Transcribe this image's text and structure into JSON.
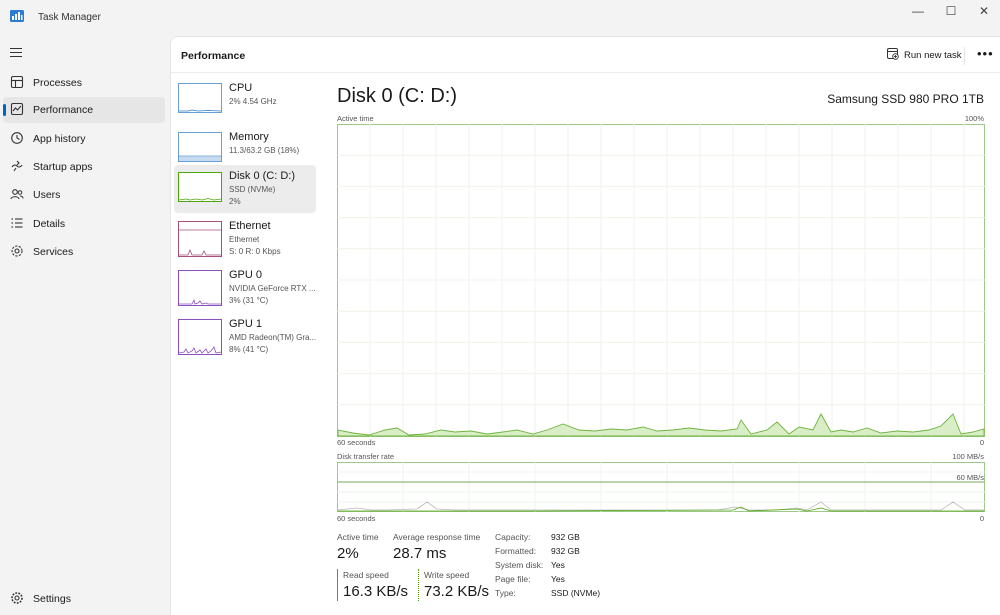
{
  "window": {
    "title": "Task Manager",
    "controls": [
      "—",
      "☐",
      "✕"
    ]
  },
  "sidebar": {
    "items": [
      {
        "label": "Processes",
        "icon": "processes-icon"
      },
      {
        "label": "Performance",
        "icon": "performance-icon",
        "active": true
      },
      {
        "label": "App history",
        "icon": "history-icon"
      },
      {
        "label": "Startup apps",
        "icon": "startup-icon"
      },
      {
        "label": "Users",
        "icon": "users-icon"
      },
      {
        "label": "Details",
        "icon": "details-icon"
      },
      {
        "label": "Services",
        "icon": "services-icon"
      }
    ],
    "settings": "Settings"
  },
  "header": {
    "title": "Performance",
    "run_new_task": "Run new task",
    "more": "•••"
  },
  "devices": [
    {
      "name": "CPU",
      "line1": "2%  4.54 GHz",
      "line2": ""
    },
    {
      "name": "Memory",
      "line1": "11.3/63.2 GB (18%)",
      "line2": ""
    },
    {
      "name": "Disk 0 (C: D:)",
      "line1": "SSD (NVMe)",
      "line2": "2%",
      "active": true
    },
    {
      "name": "Ethernet",
      "line1": "Ethernet",
      "line2": "S: 0  R: 0 Kbps"
    },
    {
      "name": "GPU 0",
      "line1": "NVIDIA GeForce RTX ...",
      "line2": "3%  (31 °C)"
    },
    {
      "name": "GPU 1",
      "line1": "AMD Radeon(TM) Gra...",
      "line2": "8%  (41 °C)"
    }
  ],
  "detail": {
    "title": "Disk 0 (C: D:)",
    "model": "Samsung SSD 980 PRO 1TB",
    "graph1": {
      "label": "Active time",
      "max": "100%",
      "xlabel": "60 seconds",
      "min": "0"
    },
    "graph2": {
      "label": "Disk transfer rate",
      "max": "100 MB/s",
      "line_label": "60 MB/s",
      "xlabel": "60 seconds",
      "min": "0"
    },
    "stats": {
      "active_time_label": "Active time",
      "active_time": "2%",
      "avg_resp_label": "Average response time",
      "avg_resp": "28.7 ms",
      "read_label": "Read speed",
      "read": "16.3 KB/s",
      "write_label": "Write speed",
      "write": "73.2 KB/s"
    },
    "props": [
      {
        "k": "Capacity:",
        "v": "932 GB"
      },
      {
        "k": "Formatted:",
        "v": "932 GB"
      },
      {
        "k": "System disk:",
        "v": "Yes"
      },
      {
        "k": "Page file:",
        "v": "Yes"
      },
      {
        "k": "Type:",
        "v": "SSD (NVMe)"
      }
    ]
  },
  "colors": {
    "disk": "#4da60c",
    "disk_fill": "#dcefc9",
    "memory": "#6a9fd4",
    "ethernet": "#a74f7b",
    "gpu": "#8c4fc1",
    "cpu": "#2f7fd6"
  }
}
